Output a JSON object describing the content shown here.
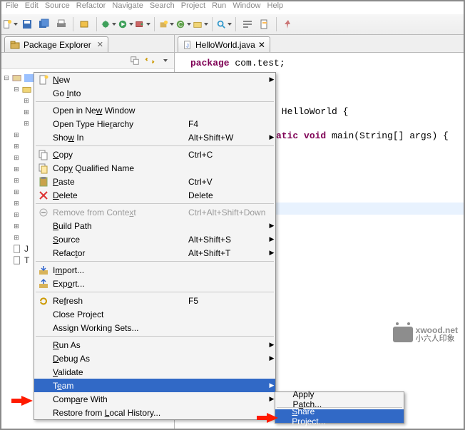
{
  "menubar": [
    "File",
    "Edit",
    "Source",
    "Refactor",
    "Navigate",
    "Search",
    "Project",
    "Run",
    "Window",
    "Help"
  ],
  "left_panel": {
    "tab_label": "Package Explorer",
    "tree": {
      "items": [
        "J",
        "T"
      ]
    }
  },
  "editor": {
    "tab_label": "HelloWorld.java",
    "lines": {
      "l1a": "package",
      "l1b": " com.test;",
      "l3b": " HelloWorld {",
      "l5a": "atic ",
      "l5kw": "void",
      "l5b": " main(String[] args) {"
    }
  },
  "context_menu": [
    {
      "label": "New",
      "accel": "",
      "sub": true,
      "icon": "new"
    },
    {
      "label": "Go Into",
      "accel": "",
      "sub": false
    },
    {
      "sep": true
    },
    {
      "label": "Open in New Window",
      "accel": "",
      "sub": false
    },
    {
      "label": "Open Type Hierarchy",
      "accel": "F4",
      "sub": false
    },
    {
      "label": "Show In",
      "accel": "Alt+Shift+W",
      "sub": true
    },
    {
      "sep": true
    },
    {
      "label": "Copy",
      "accel": "Ctrl+C",
      "sub": false,
      "icon": "copy"
    },
    {
      "label": "Copy Qualified Name",
      "accel": "",
      "sub": false,
      "icon": "copy-q"
    },
    {
      "label": "Paste",
      "accel": "Ctrl+V",
      "sub": false,
      "icon": "paste"
    },
    {
      "label": "Delete",
      "accel": "Delete",
      "sub": false,
      "icon": "delete"
    },
    {
      "sep": true
    },
    {
      "label": "Remove from Context",
      "accel": "Ctrl+Alt+Shift+Down",
      "sub": false,
      "icon": "remove",
      "disabled": true
    },
    {
      "label": "Build Path",
      "accel": "",
      "sub": true
    },
    {
      "label": "Source",
      "accel": "Alt+Shift+S",
      "sub": true
    },
    {
      "label": "Refactor",
      "accel": "Alt+Shift+T",
      "sub": true
    },
    {
      "sep": true
    },
    {
      "label": "Import...",
      "accel": "",
      "sub": false,
      "icon": "import"
    },
    {
      "label": "Export...",
      "accel": "",
      "sub": false,
      "icon": "export"
    },
    {
      "sep": true
    },
    {
      "label": "Refresh",
      "accel": "F5",
      "sub": false,
      "icon": "refresh"
    },
    {
      "label": "Close Project",
      "accel": "",
      "sub": false
    },
    {
      "label": "Assign Working Sets...",
      "accel": "",
      "sub": false
    },
    {
      "sep": true
    },
    {
      "label": "Run As",
      "accel": "",
      "sub": true
    },
    {
      "label": "Debug As",
      "accel": "",
      "sub": true
    },
    {
      "label": "Validate",
      "accel": "",
      "sub": false
    },
    {
      "label": "Team",
      "accel": "",
      "sub": true,
      "highlight": true
    },
    {
      "label": "Compare With",
      "accel": "",
      "sub": true
    },
    {
      "label": "Restore from Local History...",
      "accel": "",
      "sub": false
    }
  ],
  "submenu": [
    {
      "label": "Apply Patch..."
    },
    {
      "sep": true
    },
    {
      "label": "Share Project...",
      "highlight": true
    }
  ],
  "watermark": {
    "brand": "xwood.net",
    "sub": "小六人印象"
  }
}
